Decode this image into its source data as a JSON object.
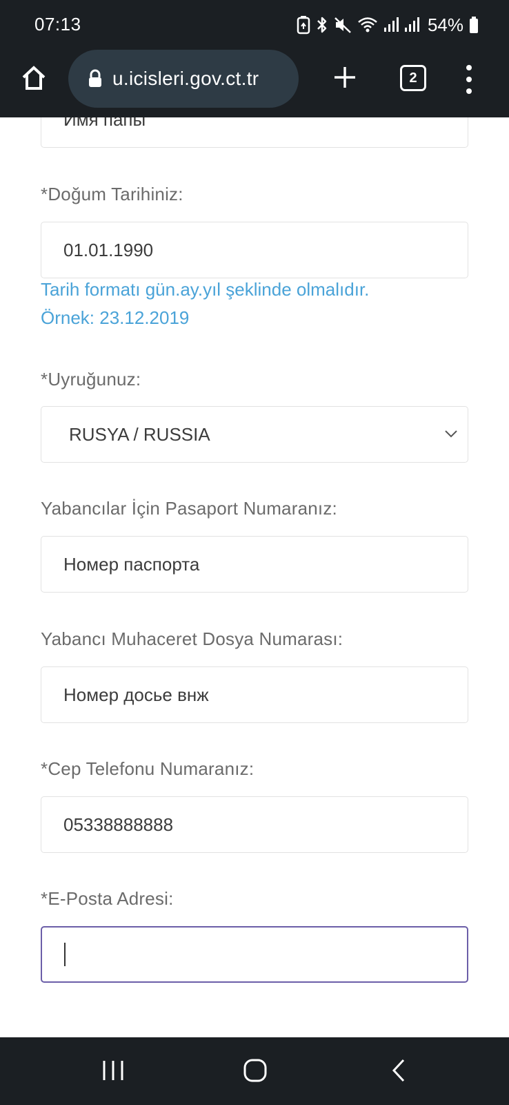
{
  "status_bar": {
    "time": "07:13",
    "battery_percent": "54%"
  },
  "browser": {
    "url": "u.icisleri.gov.ct.tr",
    "tab_count": "2"
  },
  "form": {
    "father_name_value": "Имя папы",
    "birth_date": {
      "label": "*Doğum Tarihiniz:",
      "value": "01.01.1990",
      "hint_line1": "Tarih formatı gün.ay.yıl şeklinde olmalıdır.",
      "hint_line2": "Örnek: 23.12.2019"
    },
    "nationality": {
      "label": "*Uyruğunuz:",
      "selected": "RUSYA / RUSSIA"
    },
    "passport": {
      "label": "Yabancılar İçin Pasaport Numaranız:",
      "value": "Номер паспорта"
    },
    "migration_file": {
      "label": "Yabancı Muhaceret Dosya Numarası:",
      "value": "Номер досье внж"
    },
    "phone": {
      "label": "*Cep Telefonu Numaranız:",
      "value": "05338888888"
    },
    "email": {
      "label": "*E-Posta Adresi:",
      "value": ""
    }
  },
  "colors": {
    "chrome_background": "#1b1f23",
    "url_pill": "#2e3b45",
    "hint_blue": "#4aa3d8",
    "focus_border": "#6b5ea8"
  },
  "icons": {
    "status": [
      "battery-saver-icon",
      "bluetooth-icon",
      "mute-icon",
      "wifi-icon",
      "signal-icon",
      "signal-icon",
      "battery-icon"
    ],
    "toolbar": [
      "home-icon",
      "lock-icon",
      "plus-icon",
      "tab-switcher-icon",
      "more-menu-icon"
    ],
    "nav": [
      "recent-apps-icon",
      "home-nav-icon",
      "back-icon"
    ]
  }
}
